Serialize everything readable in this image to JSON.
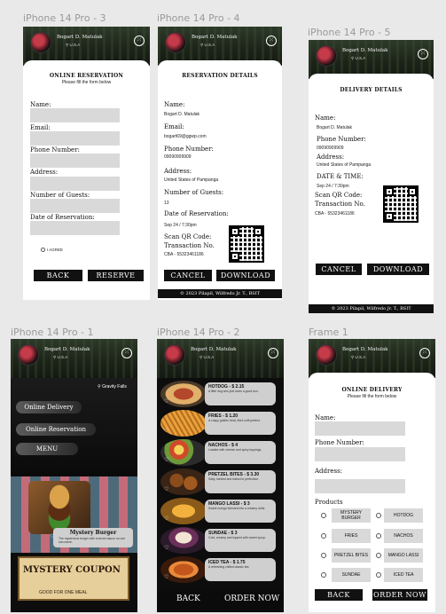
{
  "frames": {
    "f3": "iPhone 14 Pro - 3",
    "f4": "iPhone 14 Pro - 4",
    "f5": "iPhone 14 Pro - 5",
    "f1": "iPhone 14 Pro - 1",
    "f2": "iPhone 14 Pro - 2",
    "frame1": "Frame 1"
  },
  "user": {
    "name": "Bogart D. Matulak",
    "location": "U.S.A"
  },
  "reservation_form": {
    "title": "ONLINE RESERVATION",
    "subtitle": "Please fill the form below",
    "name_label": "Name:",
    "email_label": "Email:",
    "phone_label": "Phone Number:",
    "address_label": "Address:",
    "guests_label": "Number of Guests:",
    "date_label": "Date of Reservation:",
    "agree_label": "I AGREE",
    "back": "BACK",
    "reserve": "RESERVE"
  },
  "reservation_details": {
    "title": "RESERVATION DETAILS",
    "name_label": "Name:",
    "name": "Bogart D. Matulak",
    "email_label": "Email:",
    "email": "bogart69@ggwp.com",
    "phone_label": "Phone Number:",
    "phone": "09090909909",
    "address_label": "Address:",
    "address": "United States of Pampanga",
    "guests_label": "Number of Guests:",
    "guests": "13",
    "date_label": "Date of Reservation:",
    "date": "Sep 24 / 7:30pm",
    "scan_label": "Scan QR Code:",
    "txn_label": "Transaction No.",
    "txn": "CBA - 55323461186",
    "cancel": "CANCEL",
    "download": "DOWNLOAD",
    "footer": "© 2023 Pilapil, Wilfredo Jr. T., BSIT"
  },
  "delivery_details": {
    "title": "DELIVERY DETAILS",
    "name_label": "Name:",
    "name": "Bogart D. Matulak",
    "phone_label": "Phone Number:",
    "phone": "09090909909",
    "address_label": "Address:",
    "address": "United States of Pampanga",
    "datetime_label": "DATE & TIME:",
    "datetime": "Sep 24 / 7:30pm",
    "scan_label": "Scan QR Code:",
    "txn_label": "Transaction No.",
    "txn": "CBA - 55323461186",
    "cancel": "CANCEL",
    "download": "DOWNLOAD",
    "footer": "© 2023 Pilapil, Wilfredo Jr. T., BSIT"
  },
  "home": {
    "location": "Gravity Falls",
    "online_delivery": "Online Delivery",
    "online_reservation": "Online Reservation",
    "menu": "MENU",
    "mystery_burger": "Mystery Burger",
    "mystery_burger_desc": "The mysterious burger with a secret sauce no one can name.",
    "coupon": "MYSTERY COUPON",
    "coupon_sub": "GOOD FOR ONE MEAL"
  },
  "menu": {
    "items": [
      {
        "name": "HOTDOG - $ 2.15",
        "desc": "A little dog who just loves a good bun."
      },
      {
        "name": "FRIES - $ 1.20",
        "desc": "A crispy golden treat, fried until perfect."
      },
      {
        "name": "NACHOS - $ 4",
        "desc": "Loaded with cheese and spicy toppings."
      },
      {
        "name": "PRETZEL BITES - $ 3.30",
        "desc": "Salty, twisted and baked to perfection."
      },
      {
        "name": "MANGO LASSI - $ 3",
        "desc": "Sweet mango blended into a creamy drink."
      },
      {
        "name": "SUNDAE - $ 3",
        "desc": "Cold, creamy and topped with sweet syrup."
      },
      {
        "name": "ICED TEA - $ 1.75",
        "desc": "A refreshing chilled classic tea."
      }
    ],
    "back": "BACK",
    "order_now": "ORDER NOW"
  },
  "delivery_form": {
    "title": "ONLINE DELIVERY",
    "subtitle": "Please fill the form below",
    "name_label": "Name:",
    "phone_label": "Phone Number:",
    "address_label": "Address:",
    "products_label": "Products",
    "products_left": [
      "MYSTERY BURGER",
      "FRIES",
      "PRETZEL BITES",
      "SUNDAE"
    ],
    "products_right": [
      "HOTDOG",
      "NACHOS",
      "MANGO LASSI",
      "ICED TEA"
    ],
    "back": "BACK",
    "order_now": "ORDER NOW"
  }
}
